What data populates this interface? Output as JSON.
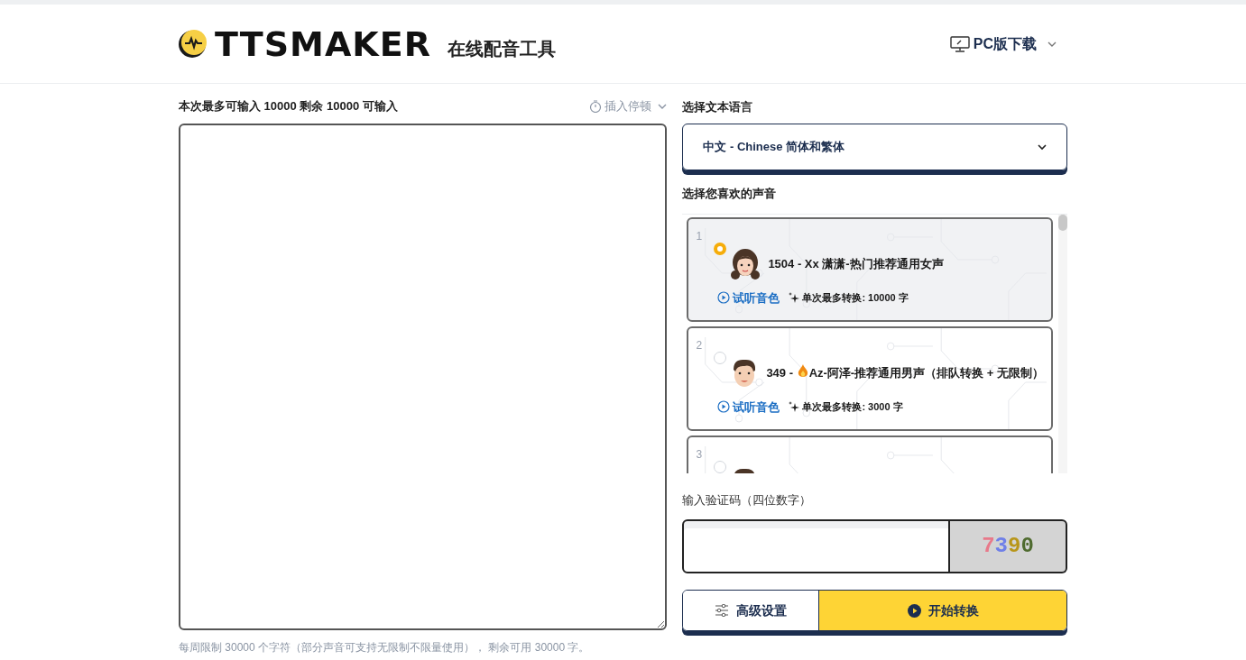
{
  "header": {
    "logo": "TTSMAKER",
    "subtitle": "在线配音工具",
    "download": "PC版下载"
  },
  "editor": {
    "limit_note": "本次最多可输入 10000 剩余 10000 可输入",
    "pause_menu": "插入停顿",
    "footer_note": "每周限制 30000 个字符（部分声音可支持无限制不限量使用）， 剩余可用 30000 字。"
  },
  "language": {
    "label": "选择文本语言",
    "value": "中文 - Chinese 简体和繁体"
  },
  "voices": {
    "label": "选择您喜欢的声音",
    "items": [
      {
        "index": "1",
        "selected": true,
        "kind": "female",
        "hot": false,
        "title": "1504 - Xx 潇潇-热门推荐通用女声",
        "listen": "试听音色",
        "max": "单次最多转换: 10000 字"
      },
      {
        "index": "2",
        "selected": false,
        "kind": "male",
        "hot": true,
        "title_prefix": "349 - ",
        "title": "Az-阿泽-推荐通用男声（排队转换 + 无限制）",
        "listen": "试听音色",
        "max": "单次最多转换: 3000 字"
      },
      {
        "index": "3",
        "selected": false,
        "kind": "male"
      }
    ]
  },
  "captcha": {
    "label": "输入验证码（四位数字）",
    "code": "7390"
  },
  "actions": {
    "settings": "高级设置",
    "start": "开始转换"
  }
}
